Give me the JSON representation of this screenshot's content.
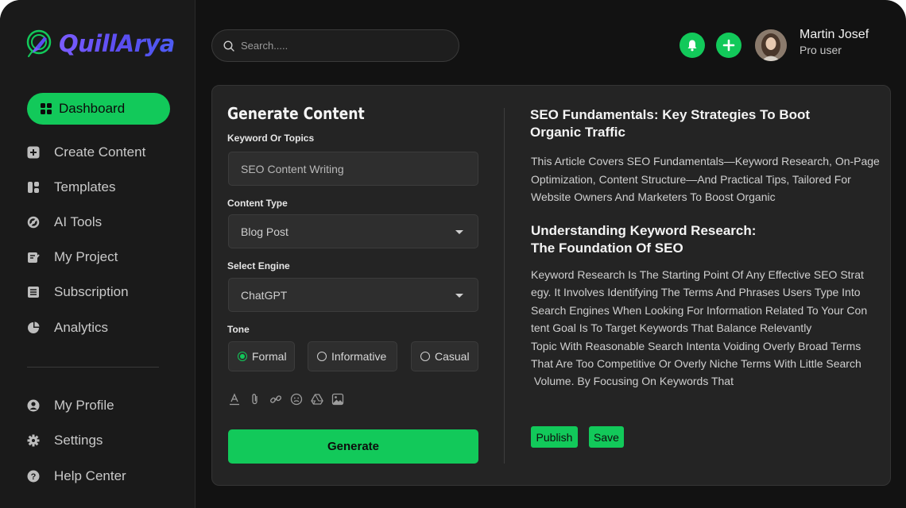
{
  "brand": {
    "name": "QuillArya"
  },
  "sidebar": {
    "active": {
      "label": "Dashboard"
    },
    "items": [
      {
        "label": "Create Content",
        "icon": "plus-square-icon"
      },
      {
        "label": "Templates",
        "icon": "templates-icon"
      },
      {
        "label": "AI Tools",
        "icon": "ai-tools-icon"
      },
      {
        "label": "My Project",
        "icon": "project-icon"
      },
      {
        "label": "Subscription",
        "icon": "subscription-icon"
      },
      {
        "label": "Analytics",
        "icon": "pie-chart-icon"
      }
    ],
    "bottom_items": [
      {
        "label": "My Profile",
        "icon": "user-icon"
      },
      {
        "label": "Settings",
        "icon": "gear-icon"
      },
      {
        "label": "Help Center",
        "icon": "help-icon"
      }
    ]
  },
  "header": {
    "search_placeholder": "Search.....",
    "user": {
      "name": "Martin Josef",
      "role": "Pro user"
    }
  },
  "form": {
    "title": "Generate Content",
    "keyword_label": "Keyword Or Topics",
    "keyword_placeholder": "SEO Content Writing",
    "content_type_label": "Content Type",
    "content_type_value": "Blog Post",
    "engine_label": "Select Engine",
    "engine_value": "ChatGPT",
    "tone_label": "Tone",
    "tones": [
      {
        "label": "Formal",
        "selected": true
      },
      {
        "label": "Informative",
        "selected": false
      },
      {
        "label": "Casual",
        "selected": false
      }
    ],
    "toolbar_icons": [
      "text-format-icon",
      "attachment-icon",
      "link-icon",
      "emoji-icon",
      "drive-icon",
      "image-icon"
    ],
    "generate_label": "Generate"
  },
  "article": {
    "title": "SEO Fundamentals: Key Strategies To Boot Organic Traffic",
    "intro": "This Article Covers SEO Fundamentals—Keyword Research, On-Page Optimization, Content Structure—And Practical Tips, Tailored For Website Owners And Marketers To Boost Organic",
    "section_title_line1": "Understanding Keyword Research:",
    "section_title_line2": "The Foundation Of SEO",
    "body_lines": [
      "Keyword Research Is The Starting Point Of Any Effective SEO Strat",
      "egy. It Involves Identifying The Terms And Phrases Users Type Into",
      "Search Engines When Looking For Information Related To Your Con",
      "tent Goal Is To Target Keywords That Balance Relevantly",
      "Topic With Reasonable Search Intenta Voiding Overly Broad Terms",
      "That Are Too Competitive Or Overly Niche Terms With Little Search",
      " Volume. By Focusing On Keywords That"
    ],
    "publish_label": "Publish",
    "save_label": "Save"
  },
  "colors": {
    "accent": "#12c95a",
    "background": "#121212",
    "sidebar": "#1a1a1a",
    "card": "#242424",
    "brand_gradient": [
      "#7b5cff",
      "#4d5cf2"
    ]
  }
}
